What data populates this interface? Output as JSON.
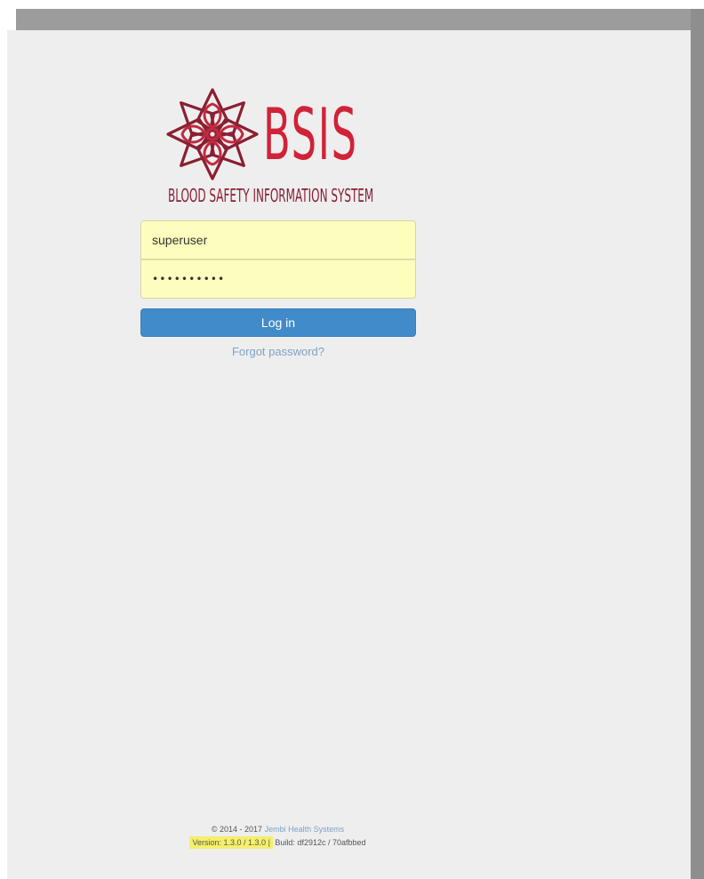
{
  "logo": {
    "brand_name": "BSIS",
    "tagline": "BLOOD SAFETY INFORMATION SYSTEM"
  },
  "login_form": {
    "username_value": "superuser",
    "password_value": "••••••••••",
    "login_label": "Log in",
    "forgot_password_label": "Forgot password?"
  },
  "footer": {
    "copyright": "© 2014 - 2017",
    "company_link": "Jembi Health Systems",
    "version_text": "Version: 1.3.0 / 1.3.0",
    "separator": "|",
    "build_text": "Build: df2912c / 70afbbed"
  },
  "colors": {
    "brand_red": "#d02338",
    "brand_dark_red": "#8a1f33",
    "primary_button": "#428bca",
    "autofill_yellow": "#fdfebd",
    "version_highlight": "#f4f06a"
  }
}
